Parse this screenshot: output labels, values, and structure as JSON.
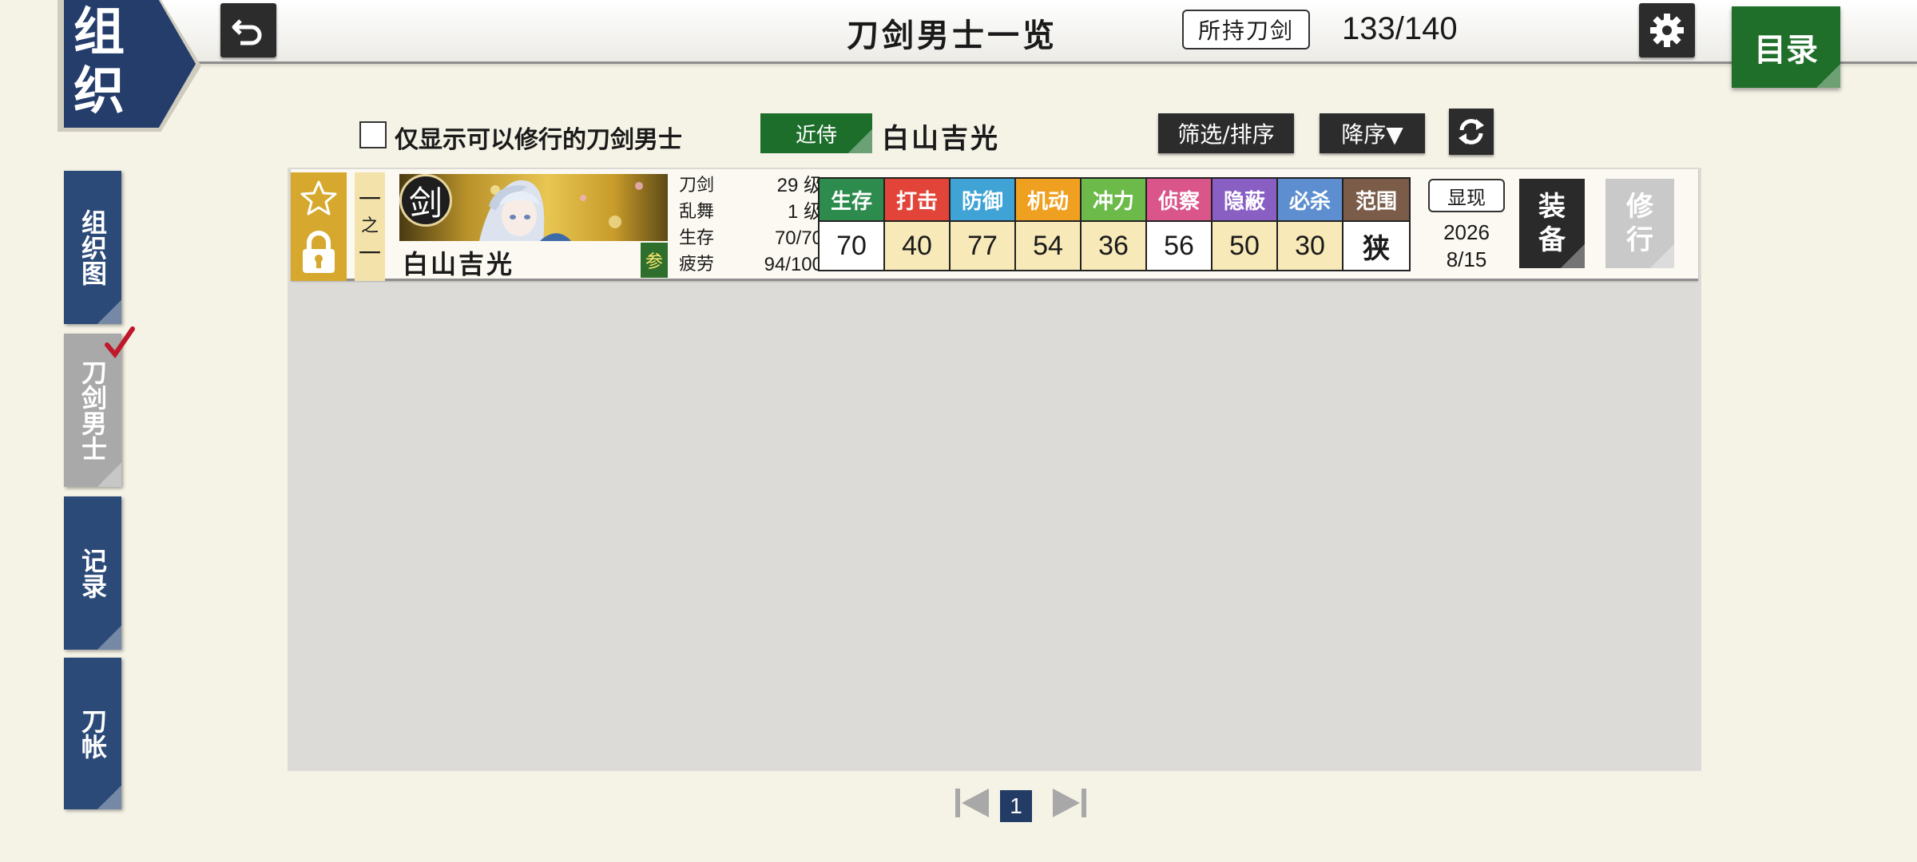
{
  "header": {
    "section_title": "组织",
    "page_title": "刀剑男士一览",
    "owned_label": "所持刀剑",
    "owned_count": "133/140",
    "menu_label": "目录"
  },
  "sidebar": {
    "items": [
      {
        "label": "组织图",
        "active": false
      },
      {
        "label": "刀剑男士",
        "active": true
      },
      {
        "label": "记录",
        "active": false
      },
      {
        "label": "刀帐",
        "active": false
      }
    ]
  },
  "filters": {
    "checkbox_label": "仅显示可以修行的刀剑男士",
    "attendant_label": "近侍",
    "attendant_name": "白山吉光",
    "filter_sort_label": "筛选/排序",
    "order_label": "降序▼"
  },
  "sword": {
    "team": [
      "一",
      "之",
      "一"
    ],
    "type_glyph": "剑",
    "name": "白山吉光",
    "rank_glyph": "参",
    "info": [
      {
        "label": "刀剑",
        "value": "29 级"
      },
      {
        "label": "乱舞",
        "value": "1 级"
      },
      {
        "label": "生存",
        "value": "70/70"
      },
      {
        "label": "疲劳",
        "value": "94/100"
      }
    ],
    "stats": [
      {
        "label": "生存",
        "value": "70",
        "color": "#2e8b4e",
        "cell_bg": "#ffffff"
      },
      {
        "label": "打击",
        "value": "40",
        "color": "#e2443a",
        "cell_bg": "#f7e9b8"
      },
      {
        "label": "防御",
        "value": "77",
        "color": "#3fa3d6",
        "cell_bg": "#f7e9b8"
      },
      {
        "label": "机动",
        "value": "54",
        "color": "#f0a020",
        "cell_bg": "#f7e9b8"
      },
      {
        "label": "冲力",
        "value": "36",
        "color": "#6cba4a",
        "cell_bg": "#f7e9b8"
      },
      {
        "label": "侦察",
        "value": "56",
        "color": "#d9558a",
        "cell_bg": "#ffffff"
      },
      {
        "label": "隐蔽",
        "value": "50",
        "color": "#8a5fc4",
        "cell_bg": "#f7e9b8"
      },
      {
        "label": "必杀",
        "value": "30",
        "color": "#5d8fd0",
        "cell_bg": "#f7e9b8"
      },
      {
        "label": "范围",
        "value": "狭",
        "color": "#7a5c48",
        "cell_bg": "#ffffff"
      }
    ],
    "manifest_label": "显现",
    "manifest_year": "2026",
    "manifest_date": "8/15",
    "equip_label": [
      "装",
      "备"
    ],
    "train_label": [
      "修",
      "行"
    ]
  },
  "pagination": {
    "current_page": "1"
  }
}
